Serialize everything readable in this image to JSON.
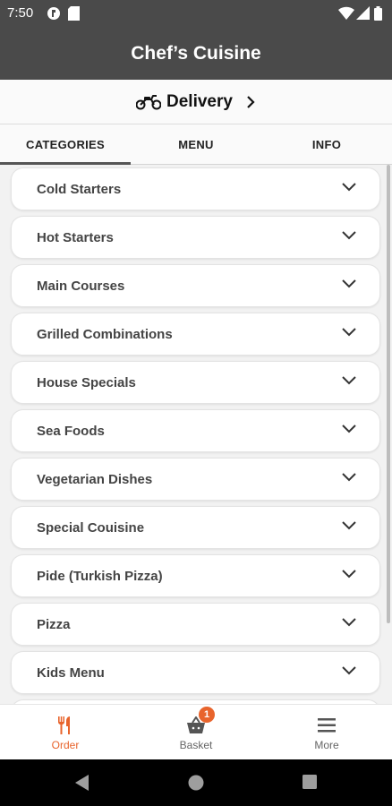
{
  "status_bar": {
    "time": "7:50"
  },
  "app_bar": {
    "title": "Chef’s Cuisine"
  },
  "delivery": {
    "label": "Delivery"
  },
  "tabs": [
    {
      "label": "CATEGORIES",
      "active": true
    },
    {
      "label": "MENU",
      "active": false
    },
    {
      "label": "INFO",
      "active": false
    }
  ],
  "categories": [
    "Cold Starters",
    "Hot Starters",
    "Main Courses",
    "Grilled Combinations",
    "House Specials",
    "Sea Foods",
    "Vegetarian Dishes",
    "Special Couisine",
    "Pide (Turkish Pizza)",
    "Pizza",
    "Kids Menu"
  ],
  "bottom_nav": {
    "order": {
      "label": "Order",
      "icon": "fork-knife-icon"
    },
    "basket": {
      "label": "Basket",
      "icon": "basket-icon",
      "badge": "1"
    },
    "more": {
      "label": "More",
      "icon": "hamburger-menu-icon"
    }
  },
  "colors": {
    "accent": "#e8642c",
    "app_bar": "#4a4a4a"
  }
}
